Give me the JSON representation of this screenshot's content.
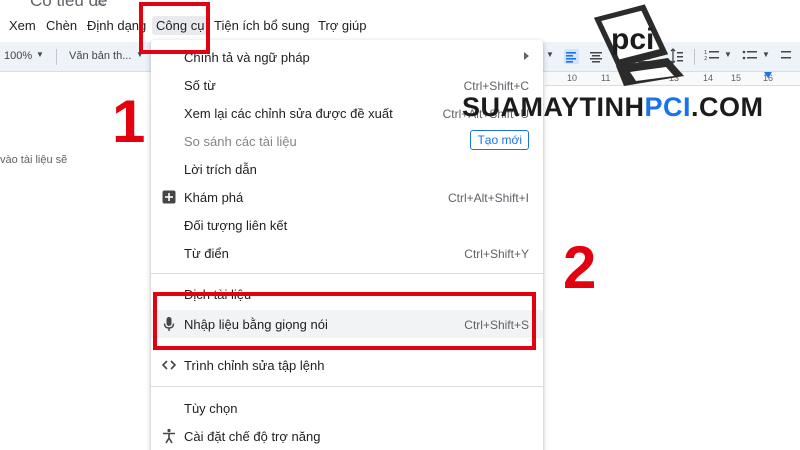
{
  "document": {
    "title": "Có tiêu đề",
    "body_text": "vào tài liệu sẽ"
  },
  "menubar": {
    "items": [
      "Xem",
      "Chèn",
      "Định dạng",
      "Công cụ",
      "Tiện ích bổ sung",
      "Trợ giúp"
    ],
    "active": "Công cụ"
  },
  "toolbar": {
    "zoom": "100%",
    "style": "Văn bản th...",
    "ruler": [
      "10",
      "11",
      "12",
      "13",
      "14",
      "15",
      "16"
    ]
  },
  "tools_menu": {
    "items": [
      {
        "label": "Chính tả và ngữ pháp",
        "shortcut": "",
        "submenu": true
      },
      {
        "label": "Số từ",
        "shortcut": "Ctrl+Shift+C"
      },
      {
        "label": "Xem lại các chỉnh sửa được đề xuất",
        "shortcut": "Ctrl+Alt+Shift+U"
      },
      {
        "label": "So sánh các tài liệu",
        "badge": "Tạo mới",
        "disabled": true
      },
      {
        "label": "Lời trích dẫn",
        "shortcut": ""
      },
      {
        "label": "Khám phá",
        "shortcut": "Ctrl+Alt+Shift+I",
        "icon": "explore-plus-icon"
      },
      {
        "label": "Đối tượng liên kết",
        "shortcut": ""
      },
      {
        "label": "Từ điển",
        "shortcut": "Ctrl+Shift+Y"
      },
      {
        "label": "Dịch tài liệu",
        "shortcut": ""
      },
      {
        "label": "Nhập liệu bằng giọng nói",
        "shortcut": "Ctrl+Shift+S",
        "icon": "microphone-icon",
        "highlighted": true
      },
      {
        "label": "Trình chỉnh sửa tập lệnh",
        "shortcut": "",
        "icon": "code-brackets-icon"
      },
      {
        "label": "Tùy chọn",
        "shortcut": ""
      },
      {
        "label": "Cài đặt chế độ trợ năng",
        "shortcut": "",
        "icon": "accessibility-icon"
      }
    ]
  },
  "annotations": {
    "step1": "1",
    "step2": "2",
    "color": "#e3000f"
  },
  "watermark": {
    "logo_text": "pci",
    "text_part1": "SUAMAYTINH",
    "text_part2": "PCI",
    "text_part3": ".COM"
  },
  "colors": {
    "accent": "#1a73e8",
    "menu_highlight": "#f1f3f4",
    "annotation_red": "#e3000f"
  }
}
